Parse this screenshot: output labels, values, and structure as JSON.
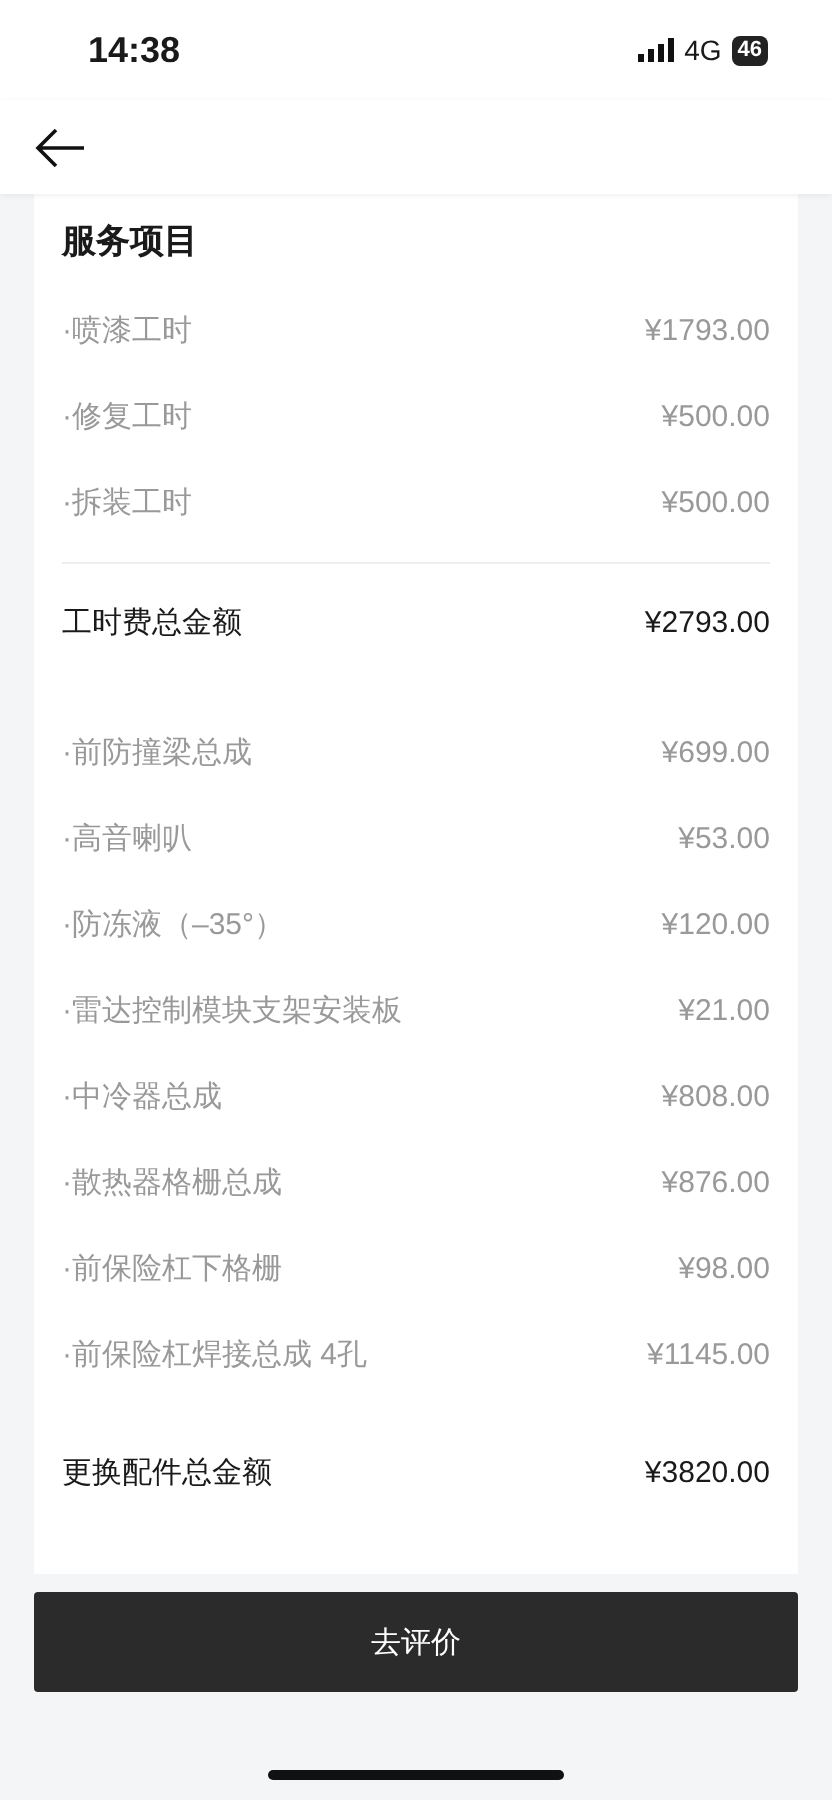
{
  "status_bar": {
    "time": "14:38",
    "network": "4G",
    "battery": "46"
  },
  "sections": [
    {
      "kind": "header",
      "title": "服务项目"
    },
    {
      "kind": "items",
      "items": [
        {
          "name": "·喷漆工时",
          "price": "¥1793.00"
        },
        {
          "name": "·修复工时",
          "price": "¥500.00"
        },
        {
          "name": "·拆装工时",
          "price": "¥500.00"
        }
      ]
    },
    {
      "kind": "total",
      "label": "工时费总金额",
      "amount": "¥2793.00"
    },
    {
      "kind": "items",
      "items": [
        {
          "name": "·前防撞梁总成",
          "price": "¥699.00"
        },
        {
          "name": "·高音喇叭",
          "price": "¥53.00"
        },
        {
          "name": "·防冻液（–35°）",
          "price": "¥120.00"
        },
        {
          "name": "·雷达控制模块支架安装板",
          "price": "¥21.00"
        },
        {
          "name": "·中冷器总成",
          "price": "¥808.00"
        },
        {
          "name": "·散热器格栅总成",
          "price": "¥876.00"
        },
        {
          "name": "·前保险杠下格栅",
          "price": "¥98.00"
        },
        {
          "name": "·前保险杠焊接总成 4孔",
          "price": "¥1145.00"
        }
      ]
    },
    {
      "kind": "total",
      "label": "更换配件总金额",
      "amount": "¥3820.00"
    }
  ],
  "action_button": "去评价"
}
